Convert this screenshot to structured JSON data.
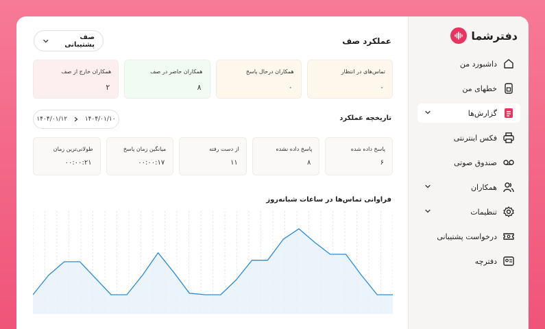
{
  "brand": {
    "name": "دفترشما",
    "color": "#e8345f"
  },
  "sidebar": {
    "items": [
      {
        "label": "داشبورد من",
        "icon": "home-icon",
        "active": false,
        "chevron": false
      },
      {
        "label": "خطهای من",
        "icon": "sim-card-icon",
        "active": false,
        "chevron": false
      },
      {
        "label": "گزارش‌ها",
        "icon": "report-icon",
        "active": true,
        "chevron": true
      },
      {
        "label": "فکس اینترنتی",
        "icon": "printer-icon",
        "active": false,
        "chevron": false
      },
      {
        "label": "صندوق صوتی",
        "icon": "voicemail-icon",
        "active": false,
        "chevron": false
      },
      {
        "label": "همکاران",
        "icon": "users-icon",
        "active": false,
        "chevron": true
      },
      {
        "label": "تنظیمات",
        "icon": "gear-icon",
        "active": false,
        "chevron": true
      },
      {
        "label": "درخواست پشتیبانی",
        "icon": "ticket-icon",
        "active": false,
        "chevron": false
      },
      {
        "label": "دفترچه",
        "icon": "contact-card-icon",
        "active": false,
        "chevron": false
      }
    ]
  },
  "main": {
    "title": "عملکرد صف",
    "queue_select": {
      "value": "صف پشتیبانی"
    },
    "stats": [
      {
        "label": "تماس‌های در انتظار",
        "value": "۰",
        "bg": "#fdf7ec"
      },
      {
        "label": "همکاران درحال پاسخ",
        "value": "۰",
        "bg": "#fdf7ec"
      },
      {
        "label": "همکاران حاضر در صف",
        "value": "۸",
        "bg": "#effbf3"
      },
      {
        "label": "همکاران خارج از صف",
        "value": "۲",
        "bg": "#fdeff0"
      }
    ],
    "history_title": "تاریخچه عملکرد",
    "date_range": {
      "from": "۱۴۰۴/۰۱/۱۰",
      "to": "۱۴۰۴/۰۱/۱۲"
    },
    "metrics": [
      {
        "label": "پاسخ داده شده",
        "value": "۶"
      },
      {
        "label": "پاسخ داده نشده",
        "value": "۸"
      },
      {
        "label": "از دست رفته",
        "value": "۱۱"
      },
      {
        "label": "میانگین زمان پاسخ",
        "value": "۰۰:۰۰:۱۷"
      },
      {
        "label": "طولانی‌ترین زمان",
        "value": "۰۰:۰۰:۲۱"
      }
    ],
    "chart_title": "فراوانی تماس‌ها در ساعات شبانه‌روز"
  },
  "chart_data": {
    "type": "line",
    "title": "فراوانی تماس‌ها در ساعات شبانه‌روز",
    "x": [
      0,
      1,
      2,
      3,
      4,
      5,
      6,
      7,
      8,
      9,
      10,
      11,
      12,
      13,
      14,
      15,
      16,
      17,
      18,
      19,
      20,
      21,
      22,
      23
    ],
    "series": [
      {
        "values": [
          1.1,
          2.4,
          3.3,
          3.3,
          2.2,
          1.1,
          1.1,
          2.4,
          3.9,
          2.6,
          1.2,
          1.1,
          1.1,
          2.1,
          3.4,
          3.4,
          4.8,
          5.5,
          4.6,
          3.8,
          3.8,
          2.4,
          1.1,
          1.1
        ]
      }
    ],
    "ylim": [
      0,
      6.5
    ],
    "grid": "vertical-dashed",
    "line_color": "#2a8ad6",
    "fill_color": "#e6f0fa"
  }
}
